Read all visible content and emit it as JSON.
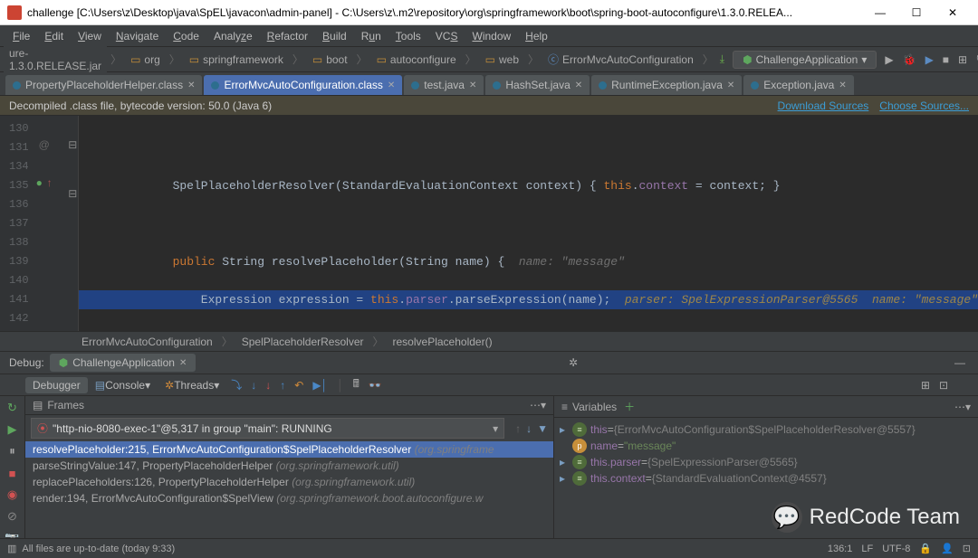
{
  "window": {
    "title": "challenge [C:\\Users\\z\\Desktop\\java\\SpEL\\javacon\\admin-panel] - C:\\Users\\z\\.m2\\repository\\org\\springframework\\boot\\spring-boot-autoconfigure\\1.3.0.RELEA..."
  },
  "menubar": [
    "File",
    "Edit",
    "View",
    "Navigate",
    "Code",
    "Analyze",
    "Refactor",
    "Build",
    "Run",
    "Tools",
    "VCS",
    "Window",
    "Help"
  ],
  "breadcrumbs": [
    "ure-1.3.0.RELEASE.jar",
    "org",
    "springframework",
    "boot",
    "autoconfigure",
    "web",
    "ErrorMvcAutoConfiguration"
  ],
  "runconfig": "ChallengeApplication",
  "editor_tabs": [
    {
      "label": "PropertyPlaceholderHelper.class",
      "active": false
    },
    {
      "label": "ErrorMvcAutoConfiguration.class",
      "active": true
    },
    {
      "label": "test.java",
      "active": false
    },
    {
      "label": "HashSet.java",
      "active": false
    },
    {
      "label": "RuntimeException.java",
      "active": false
    },
    {
      "label": "Exception.java",
      "active": false
    }
  ],
  "decompiled": {
    "msg": "Decompiled .class file, bytecode version: 50.0 (Java 6)",
    "link1": "Download Sources",
    "link2": "Choose Sources..."
  },
  "gutter": [
    "130",
    "131",
    "134",
    "135",
    "136",
    "137",
    "138",
    "139",
    "140",
    "141",
    "142"
  ],
  "code": {
    "l131": "            SpelPlaceholderResolver(StandardEvaluationContext context) { this.context = context; }",
    "l135_hint": "name: \"message\"",
    "l136_hint": "parser: SpelExpressionParser@5565  name: \"message\""
  },
  "bc2": [
    "ErrorMvcAutoConfiguration",
    "SpelPlaceholderResolver",
    "resolvePlaceholder()"
  ],
  "debug": {
    "header": "Debug:",
    "tab": "ChallengeApplication",
    "tabs": {
      "debugger": "Debugger",
      "console": "Console",
      "threads": "Threads"
    },
    "frames_title": "Frames",
    "vars_title": "Variables",
    "thread": "\"http-nio-8080-exec-1\"@5,317 in group \"main\": RUNNING",
    "frames": [
      {
        "txt": "resolvePlaceholder:215, ErrorMvcAutoConfiguration$SpelPlaceholderResolver",
        "pkg": "(org.springframe",
        "sel": true
      },
      {
        "txt": "parseStringValue:147, PropertyPlaceholderHelper",
        "pkg": "(org.springframework.util)",
        "sel": false
      },
      {
        "txt": "replacePlaceholders:126, PropertyPlaceholderHelper",
        "pkg": "(org.springframework.util)",
        "sel": false
      },
      {
        "txt": "render:194, ErrorMvcAutoConfiguration$SpelView",
        "pkg": "(org.springframework.boot.autoconfigure.w",
        "sel": false
      }
    ],
    "vars": [
      {
        "name": "this",
        "eq": " = ",
        "val": "{ErrorMvcAutoConfiguration$SpelPlaceholderResolver@5557}",
        "icon": "t",
        "expand": true
      },
      {
        "name": "name",
        "eq": " = ",
        "val": "\"message\"",
        "icon": "p",
        "str": true
      },
      {
        "name": "this.parser",
        "eq": " = ",
        "val": "{SpelExpressionParser@5565}",
        "icon": "f",
        "expand": true
      },
      {
        "name": "this.context",
        "eq": " = ",
        "val": "{StandardEvaluationContext@4557}",
        "icon": "f",
        "expand": true
      }
    ]
  },
  "status": {
    "left": "All files are up-to-date (today 9:33)",
    "pos": "136:1",
    "le": "LF",
    "enc": "UTF-8"
  },
  "watermark": "RedCode Team"
}
